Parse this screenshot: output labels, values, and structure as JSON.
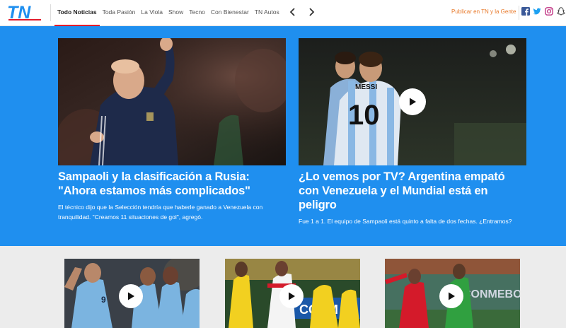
{
  "brand": {
    "logo_text": "TN",
    "accent": "#1f8fef",
    "red": "#e21b2b"
  },
  "nav": {
    "items": [
      {
        "label": "Todo Noticias",
        "active": true
      },
      {
        "label": "Toda Pasión",
        "active": false
      },
      {
        "label": "La Viola",
        "active": false
      },
      {
        "label": "Show",
        "active": false
      },
      {
        "label": "Tecno",
        "active": false
      },
      {
        "label": "Con Bienestar",
        "active": false
      },
      {
        "label": "TN Autos",
        "active": false
      }
    ],
    "prev_icon": "chevron-left-icon",
    "next_icon": "chevron-right-icon"
  },
  "header": {
    "cta_label": "Publicar en TN y la Gente",
    "social": [
      "facebook-icon",
      "twitter-icon",
      "instagram-icon",
      "snapchat-icon"
    ]
  },
  "hero": {
    "left": {
      "title": "Sampaoli y la clasificación a Rusia: \"Ahora estamos más complicados\"",
      "description": "El técnico dijo que la Selección tendría que haberle ganado a Venezuela con tranquilidad. \"Creamos 11 situaciones de gol\", agregó.",
      "has_video": false
    },
    "right": {
      "title": "¿Lo vemos por TV? Argentina empató con Venezuela y el Mundial está en peligro",
      "description": "Fue 1 a 1. El equipo de Sampaoli está quinto a falta de dos fechas. ¿Entramos?",
      "has_video": true,
      "jersey_name": "MESSI",
      "jersey_number": "10"
    }
  },
  "thumbs": [
    {
      "has_video": true,
      "jersey_number": "9"
    },
    {
      "has_video": true,
      "board_text": "CONM"
    },
    {
      "has_video": true,
      "board_text": "CONMEBOL"
    }
  ]
}
